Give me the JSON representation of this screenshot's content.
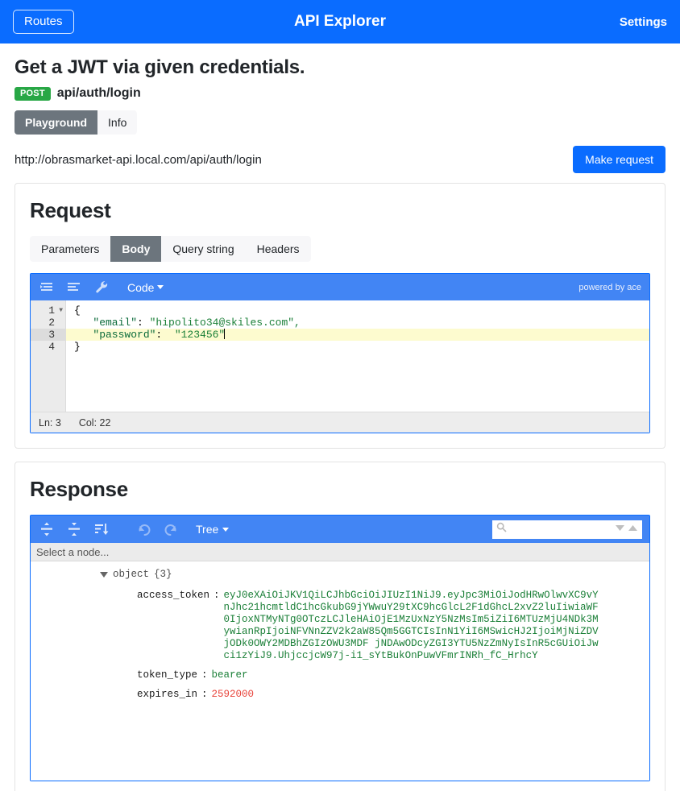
{
  "navbar": {
    "routes_label": "Routes",
    "title": "API Explorer",
    "settings_label": "Settings",
    "bg_color": "#0a6cff"
  },
  "page": {
    "title": "Get a JWT via given credentials.",
    "method": "POST",
    "method_color": "#28a745",
    "endpoint": "api/auth/login",
    "tabs": [
      {
        "label": "Playground",
        "active": true
      },
      {
        "label": "Info",
        "active": false
      }
    ],
    "url": "http://obrasmarket-api.local.com/api/auth/login",
    "make_request_label": "Make request"
  },
  "request": {
    "title": "Request",
    "tabs": [
      {
        "label": "Parameters",
        "active": false
      },
      {
        "label": "Body",
        "active": true
      },
      {
        "label": "Query string",
        "active": false
      },
      {
        "label": "Headers",
        "active": false
      }
    ],
    "editor": {
      "mode_label": "Code",
      "powered_by": "powered by ace",
      "icons": [
        "indent-lines-icon",
        "align-lines-icon",
        "wrench-icon"
      ],
      "lines": [
        {
          "num": "1",
          "foldable": true,
          "highlight": false,
          "text": "{"
        },
        {
          "num": "2",
          "foldable": false,
          "highlight": false,
          "text": "  \"email\": \"hipolito34@skiles.com\","
        },
        {
          "num": "3",
          "foldable": false,
          "highlight": true,
          "text": "  \"password\": \"123456\""
        },
        {
          "num": "4",
          "foldable": false,
          "highlight": false,
          "text": "}"
        }
      ],
      "content_email_key": "\"email\"",
      "content_email_val": "\"hipolito34@skiles.com\",",
      "content_password_key": "\"password\"",
      "content_password_val": "\"123456\"",
      "status_line": "Ln: 3",
      "status_col": "Col: 22"
    }
  },
  "response": {
    "title": "Response",
    "viewer": {
      "mode_label": "Tree",
      "search_placeholder": "",
      "node_bar_text": "Select a node...",
      "icons": [
        "expand-all-icon",
        "collapse-all-icon",
        "sort-icon",
        "undo-icon",
        "redo-icon",
        "search-icon",
        "search-next-icon",
        "search-prev-icon"
      ],
      "root_label": "object",
      "root_count": "{3}",
      "rows": [
        {
          "field": "access_token",
          "value": "eyJ0eXAiOiJKV1QiLCJhbGciOiJIUzI1NiJ9.eyJpc3MiOiJodHRwOlwvXC9vYnJhc21hcmtldC1hcGkubG9jYWwuY29tXC9hcGlcL2F1dGhcL2xvZ2luIiwiaWF0IjoxNTMyNTg0OTczLCJleHAiOjE1MzUxNzY5NzMsIm5iZiI6MTUzMjU4NDk3MywianRpIjoiNFVNnZZV2k2aW85Qm5GGTCIsInN1YiI6MSwicHJ2IjoiMjNiZDVjODk0OWY2MDBhZGIzOWU3MDF jNDAwODcyZGI3YTU5NzZmNyIsInR5cGUiOiJwci1zYiJ9.UhjccjcW97j-i1_sYtBukOnPuwVFmrINRh_fC_HrhcY",
          "value_type": "string",
          "display_lines": [
            "eyJ0eXAiOiJKV1QiLCJhbGciOiJIUzI1NiJ9.eyJpc3MiOiJodHRwOlwvXC9vYnJhc21hcm",
            "tldC1hcGkubG9jYWwuY29tXC9hcGlcL2F1dGhcL2xvZ2luIiwiaWF0IjoxNTMyNTg0OTczL",
            "CJleHAiOjE1MzUxNzY5NzMsIm5iZiI6MTUzMjU4NDk3MywianRpIjoiNFVUNnZZV2k2aW85",
            "Qm5GTCIsInN1YiI6MSwicHJ2IjoiMjNiZDVjODk0OWY2MDBhZGIzOWU3MDF jNDAwODcyZGI",
            "3YTU5NzZmNyIsInR5cGUiOiJwci1zYiJ9.UhjccjcW97j-",
            "i1_sYtBukOnPuwVFmrINRh_fC_HrhcY"
          ]
        },
        {
          "field": "token_type",
          "value": "bearer",
          "value_type": "string",
          "display_lines": [
            "bearer"
          ]
        },
        {
          "field": "expires_in",
          "value": "2592000",
          "value_type": "number",
          "display_lines": [
            "2592000"
          ]
        }
      ]
    }
  },
  "colors": {
    "accent_blue": "#0a6cff",
    "toolbar_blue": "#4285f4",
    "method_green": "#28a745",
    "string_green": "#1a7f37",
    "number_red": "#e8453c",
    "tab_active_gray": "#6c757d"
  }
}
